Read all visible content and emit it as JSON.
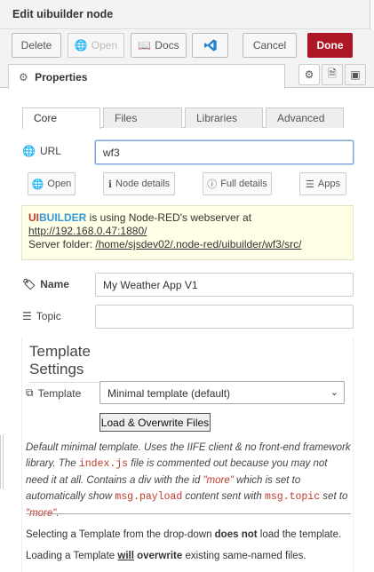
{
  "window": {
    "title": "Edit uibuilder node"
  },
  "toolbar": {
    "delete_label": "Delete",
    "open_label": "Open",
    "docs_label": "Docs",
    "cancel_label": "Cancel",
    "done_label": "Done"
  },
  "properties_tab": {
    "label": "Properties"
  },
  "tabs": {
    "core": "Core",
    "files": "Files",
    "libraries": "Libraries",
    "advanced": "Advanced"
  },
  "url": {
    "label": "URL",
    "value": "wf3"
  },
  "actions": {
    "open": "Open",
    "node_details": "Node details",
    "full_details": "Full details",
    "apps": "Apps"
  },
  "info": {
    "brand_ui": "UI",
    "brand_builder": "BUILDER",
    "line1_rest": " is using Node-RED's webserver at",
    "server_url": "http://192.168.0.47:1880/",
    "folder_label": "Server folder: ",
    "folder_path": "/home/sjsdev02/.node-red/uibuilder/wf3/src/"
  },
  "name": {
    "label": "Name",
    "value": "My Weather App V1"
  },
  "topic": {
    "label": "Topic",
    "value": ""
  },
  "template_settings": {
    "title": "Template Settings",
    "template_label": "Template",
    "selected": "Minimal template (default)",
    "load_button": "Load & Overwrite Files",
    "desc_1": "Default minimal template. Uses the IIFE client & no front-end framework library. The ",
    "desc_code1": "index.js",
    "desc_2": " file is commented out because you may not need it at all. Contains a div with the id ",
    "desc_q1": "\"more\"",
    "desc_3": " which is set to automatically show ",
    "desc_code2": "msg.payload",
    "desc_4": " content sent with ",
    "desc_code3": "msg.topic",
    "desc_5": " set to ",
    "desc_q2": "\"more\"",
    "desc_6": ".",
    "note1_a": "Selecting a Template from the drop-down ",
    "note1_b": "does not",
    "note1_c": " load the template.",
    "note2_a": "Loading a Template ",
    "note2_b": "will",
    "note2_c": " ",
    "note2_d": "overwrite",
    "note2_e": " existing same-named files."
  },
  "colors": {
    "done": "#ad1625",
    "ui_red": "#c0392b",
    "ui_blue": "#3498db",
    "info_bg": "#ffffe8"
  }
}
